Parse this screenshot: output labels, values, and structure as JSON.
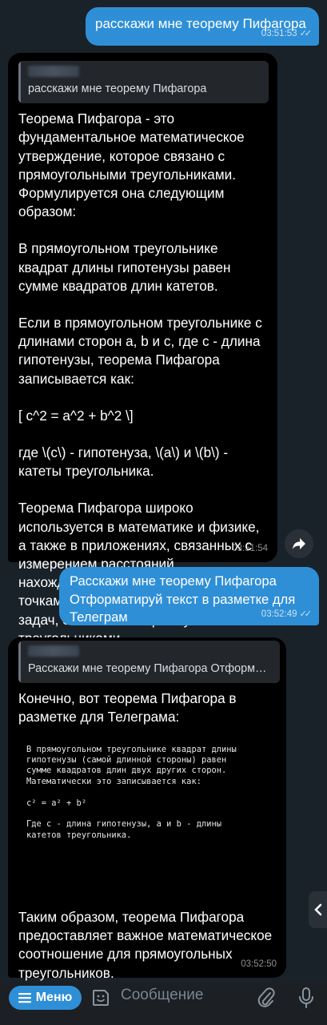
{
  "messages": [
    {
      "type": "outgoing",
      "text": "расскажи мне теорему Пифагора",
      "time": "03:51:53"
    },
    {
      "type": "incoming",
      "reply_to": "расскажи мне теорему Пифагора",
      "paragraphs": [
        "Теорема Пифагора - это фундаментальное математическое утверждение, которое связано с прямоугольными треугольниками. Формулируется она следующим образом:",
        "В прямоугольном треугольнике квадрат длины гипотенузы равен сумме квадратов длин катетов.",
        "Если в прямоугольном треугольнике с длинами сторон a, b и c, где c - длина гипотенузы, теорема Пифагора записывается как:",
        "[ c^2 = a^2 + b^2 \\]",
        "где \\(c\\) - гипотенуза, \\(a\\) и \\(b\\) - катеты треугольника.",
        "Теорема Пифагора широко используется в математике и физике, а также в приложениях, связанных с измерением расстояний, нахождением расстояний между точками в пространстве и решением задач, связанных с прямоугольными треугольниками."
      ],
      "time": "03:51:54"
    },
    {
      "type": "outgoing",
      "text": "Расскажи мне теорему Пифагора\nОтформатируй текст в разметке для Телеграм",
      "time": "03:52:49"
    },
    {
      "type": "incoming",
      "reply_to": "Расскажи мне теорему Пифагора Отформатируй текст в разметке для Телеграм",
      "intro": "Конечно, вот теорема Пифагора в разметке для Телеграма:",
      "code": "В прямоугольном треугольнике квадрат длины\nгипотенузы (самой длинной стороны) равен\nсумме квадратов длин двух других сторон.\nМатематически это записывается как:\n\nc² = a² + b²\n\nГде c - длина гипотенузы, a и b - длины\nкатетов треугольника.",
      "outro": "Таким образом, теорема Пифагора предоставляет важное математическое соотношение для прямоугольных треугольников.",
      "time": "03:52:50"
    }
  ],
  "input": {
    "menu_label": "Меню",
    "placeholder": "Сообщение"
  },
  "icons": {
    "forward": "forward-arrow-icon",
    "scroll_side": "chevron-left-icon",
    "menu": "menu-lines-icon",
    "emoji": "sticker-emoji-icon",
    "attach": "paperclip-icon",
    "mic": "microphone-icon",
    "read": "double-check-icon"
  },
  "colors": {
    "outgoing_bubble": "#2f8fd6",
    "incoming_bubble": "#000000",
    "background": "#1a2229",
    "accent": "#2f8fd6"
  }
}
